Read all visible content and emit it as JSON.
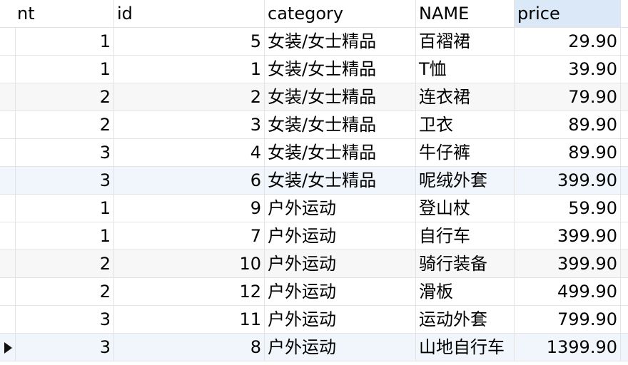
{
  "columns": {
    "nt": "nt",
    "id": "id",
    "category": "category",
    "name": "NAME",
    "price": "price"
  },
  "rows": [
    {
      "nt": "1",
      "id": "5",
      "category": "女装/女士精品",
      "name": "百褶裙",
      "price": "29.90"
    },
    {
      "nt": "1",
      "id": "1",
      "category": "女装/女士精品",
      "name": "T恤",
      "price": "39.90"
    },
    {
      "nt": "2",
      "id": "2",
      "category": "女装/女士精品",
      "name": "连衣裙",
      "price": "79.90"
    },
    {
      "nt": "2",
      "id": "3",
      "category": "女装/女士精品",
      "name": "卫衣",
      "price": "89.90"
    },
    {
      "nt": "3",
      "id": "4",
      "category": "女装/女士精品",
      "name": "牛仔裤",
      "price": "89.90"
    },
    {
      "nt": "3",
      "id": "6",
      "category": "女装/女士精品",
      "name": "呢绒外套",
      "price": "399.90"
    },
    {
      "nt": "1",
      "id": "9",
      "category": "户外运动",
      "name": "登山杖",
      "price": "59.90"
    },
    {
      "nt": "1",
      "id": "7",
      "category": "户外运动",
      "name": "自行车",
      "price": "399.90"
    },
    {
      "nt": "2",
      "id": "10",
      "category": "户外运动",
      "name": "骑行装备",
      "price": "399.90"
    },
    {
      "nt": "2",
      "id": "12",
      "category": "户外运动",
      "name": "滑板",
      "price": "499.90"
    },
    {
      "nt": "3",
      "id": "11",
      "category": "户外运动",
      "name": "运动外套",
      "price": "799.90"
    },
    {
      "nt": "3",
      "id": "8",
      "category": "户外运动",
      "name": "山地自行车",
      "price": "1399.90"
    }
  ],
  "current_row": 12,
  "sorted_column": "price",
  "colors": {
    "sorted_header": "#dbe8f7",
    "highlight_row": "#f1f6fc",
    "alt_row": "#f7f7f7",
    "grid_line": "#e3e3e3"
  }
}
